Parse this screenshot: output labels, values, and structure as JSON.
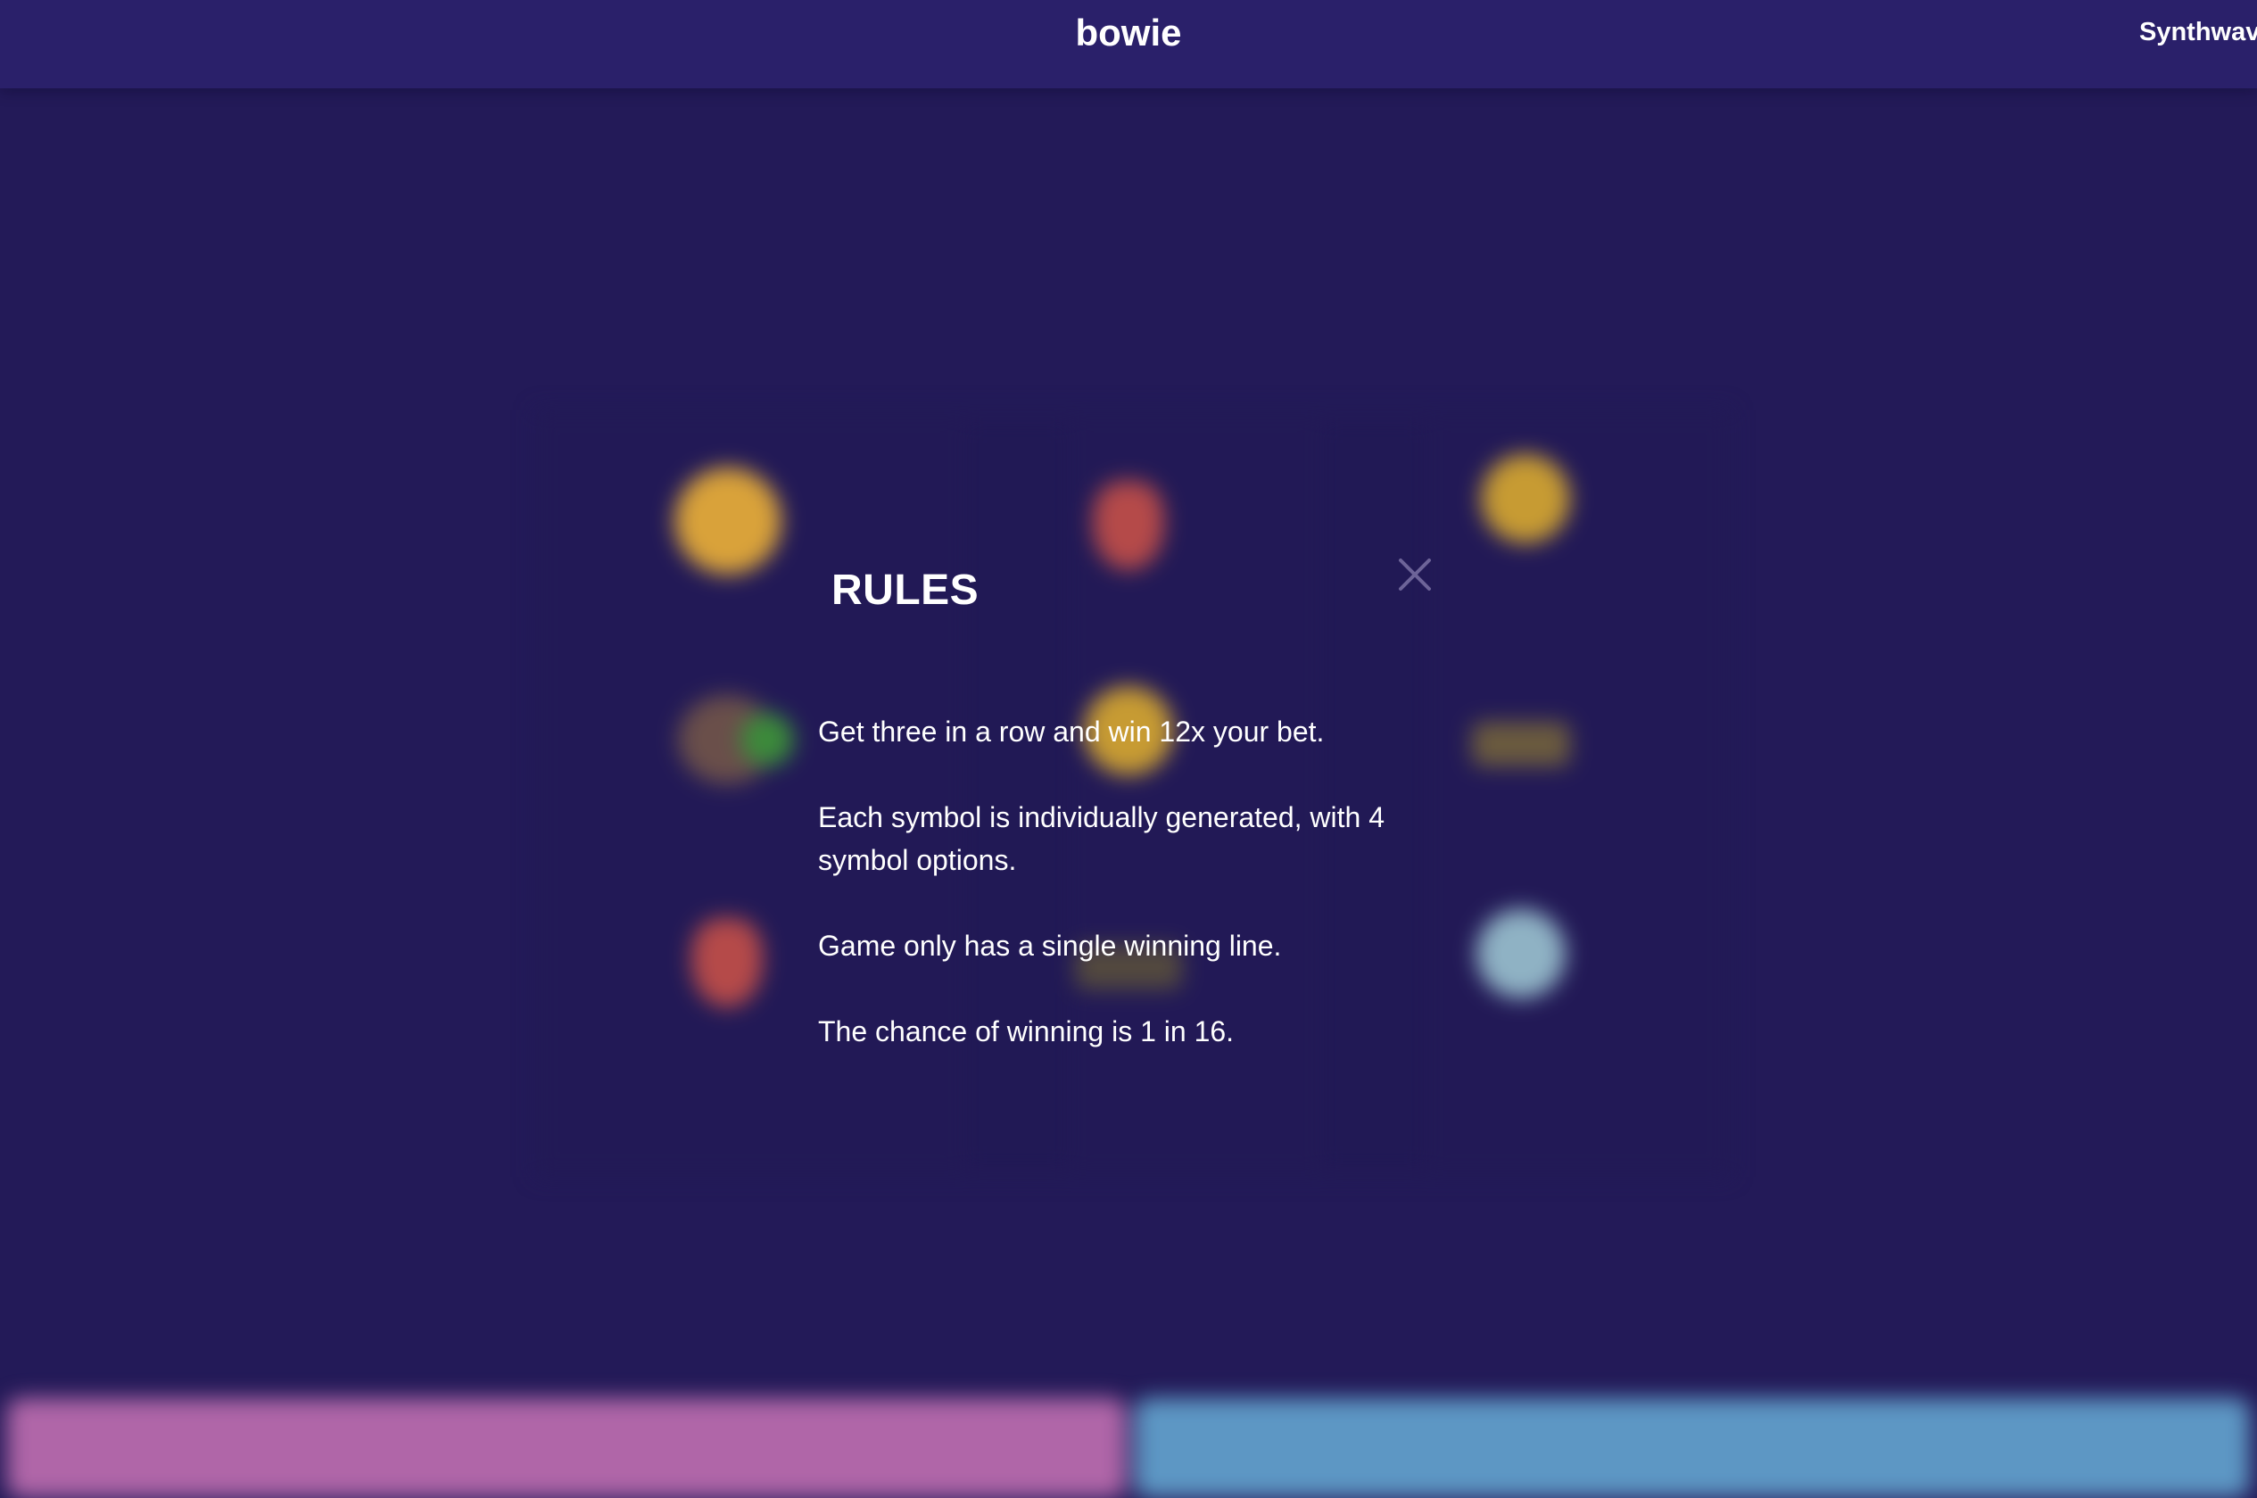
{
  "header": {
    "brand": "bowie",
    "theme_label": "Synthwav"
  },
  "modal": {
    "title": "RULES",
    "close_icon": "close-icon",
    "rules": [
      "Get three in a row and win 12x your bet.",
      "Each symbol is individually generated, with 4 symbol options.",
      "Game only has a single winning line.",
      "The chance of winning is 1 in 16."
    ]
  },
  "colors": {
    "background": "#231a58",
    "header": "#2a206a",
    "spin_bar": "#b066a8",
    "auto_bar": "#5d97c4",
    "close_icon": "#6d6498"
  },
  "symbols": {
    "reel_1": [
      "coin-icon",
      "fruit-icon",
      "heart-icon"
    ],
    "reel_2": [
      "heart-icon",
      "gold-icon",
      "dark-bar-icon"
    ],
    "reel_3": [
      "gold-icon",
      "bar-icon",
      "gem-icon"
    ]
  }
}
